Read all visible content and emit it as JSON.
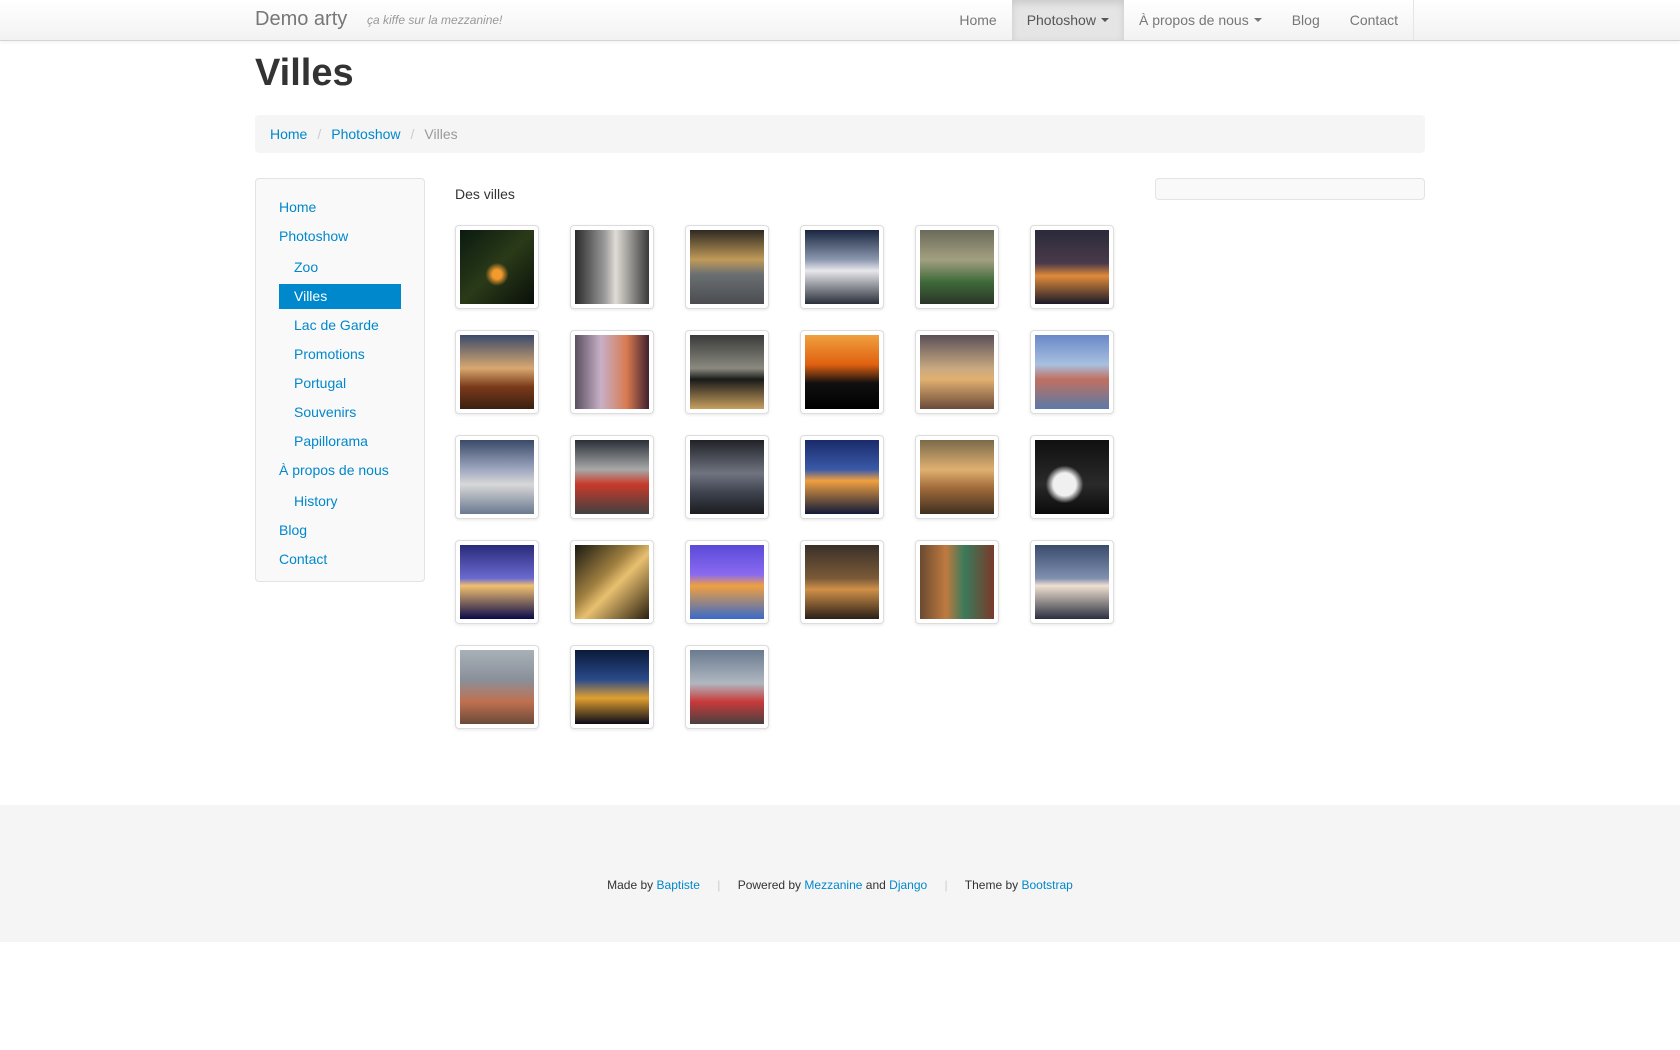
{
  "navbar": {
    "brand": "Demo arty",
    "tagline": "ça kiffe sur la mezzanine!",
    "items": [
      {
        "label": "Home"
      },
      {
        "label": "Photoshow"
      },
      {
        "label": "À propos de nous"
      },
      {
        "label": "Blog"
      },
      {
        "label": "Contact"
      }
    ]
  },
  "page": {
    "title": "Villes",
    "breadcrumb": [
      "Home",
      "Photoshow",
      "Villes"
    ]
  },
  "sidenav": {
    "items": [
      {
        "label": "Home"
      },
      {
        "label": "Photoshow"
      },
      {
        "label": "Zoo"
      },
      {
        "label": "Villes"
      },
      {
        "label": "Lac de Garde"
      },
      {
        "label": "Promotions"
      },
      {
        "label": "Portugal"
      },
      {
        "label": "Souvenirs"
      },
      {
        "label": "Papillorama"
      },
      {
        "label": "À propos de nous"
      },
      {
        "label": "History"
      },
      {
        "label": "Blog"
      },
      {
        "label": "Contact"
      }
    ]
  },
  "gallery": {
    "description": "Des villes",
    "photo_count": 27
  },
  "footer": {
    "made_by": "Made by",
    "author": "Baptiste",
    "powered_by": "Powered by",
    "mezzanine": "Mezzanine",
    "and": "and",
    "django": "Django",
    "theme_by": "Theme by",
    "bootstrap": "Bootstrap"
  },
  "colors": {
    "link": "#0088cc",
    "active_bg": "#0088cc",
    "navbar_bg": "#f8f8f8"
  }
}
